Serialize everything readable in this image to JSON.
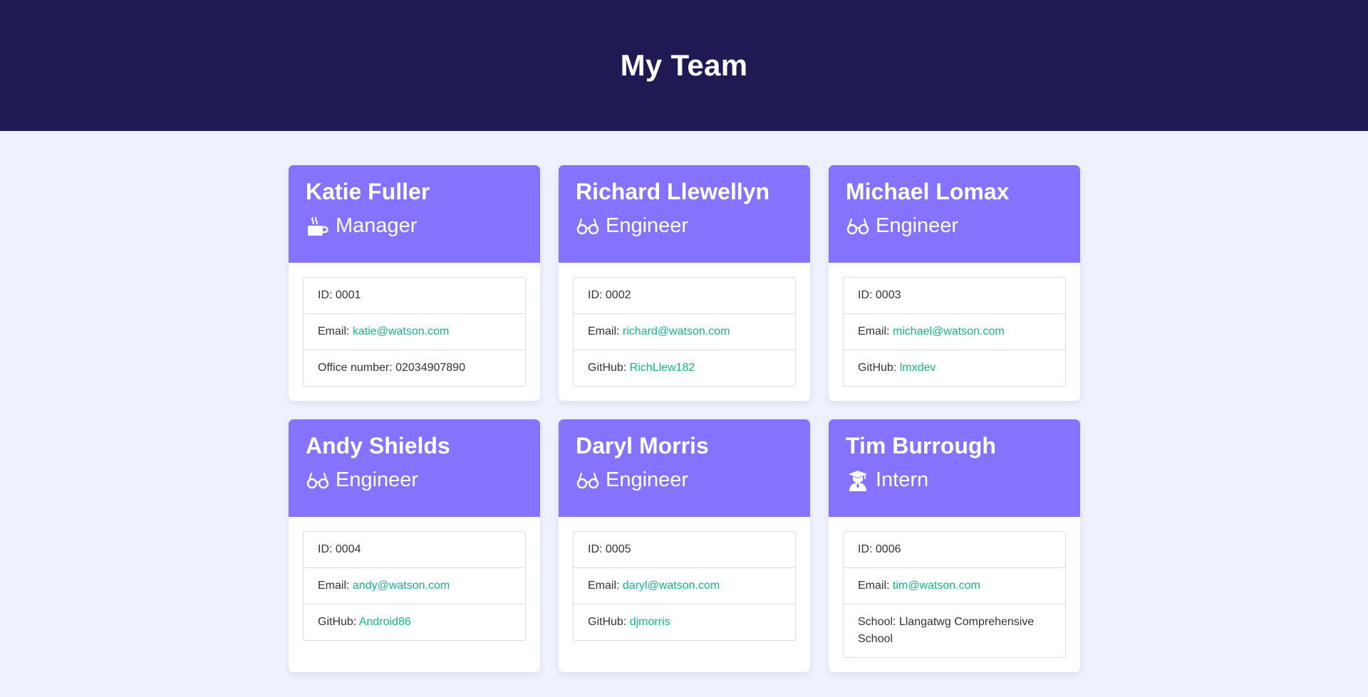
{
  "header": {
    "title": "My Team"
  },
  "colors": {
    "header_bg": "#201a54",
    "card_head_bg": "#8572ff",
    "link": "#13b38a",
    "page_bg": "#eff2fe"
  },
  "members": [
    {
      "name": "Katie Fuller",
      "role": "Manager",
      "icon": "coffee-mug-icon",
      "id_label": "ID: ",
      "id": "0001",
      "email_label": "Email: ",
      "email": "katie@watson.com",
      "extra_label": "Office number: ",
      "extra": "02034907890"
    },
    {
      "name": "Richard Llewellyn",
      "role": "Engineer",
      "icon": "glasses-icon",
      "id_label": "ID: ",
      "id": "0002",
      "email_label": "Email: ",
      "email": "richard@watson.com",
      "extra_label": "GitHub: ",
      "extra": "RichLlew182"
    },
    {
      "name": "Michael Lomax",
      "role": "Engineer",
      "icon": "glasses-icon",
      "id_label": "ID: ",
      "id": "0003",
      "email_label": "Email: ",
      "email": "michael@watson.com",
      "extra_label": "GitHub: ",
      "extra": "lmxdev"
    },
    {
      "name": "Andy Shields",
      "role": "Engineer",
      "icon": "glasses-icon",
      "id_label": "ID: ",
      "id": "0004",
      "email_label": "Email: ",
      "email": "andy@watson.com",
      "extra_label": "GitHub: ",
      "extra": "Android86"
    },
    {
      "name": "Daryl Morris",
      "role": "Engineer",
      "icon": "glasses-icon",
      "id_label": "ID: ",
      "id": "0005",
      "email_label": "Email: ",
      "email": "daryl@watson.com",
      "extra_label": "GitHub: ",
      "extra": "djmorris"
    },
    {
      "name": "Tim Burrough",
      "role": "Intern",
      "icon": "graduate-icon",
      "id_label": "ID: ",
      "id": "0006",
      "email_label": "Email: ",
      "email": "tim@watson.com",
      "extra_label": "School: ",
      "extra": "Llangatwg Comprehensive School"
    }
  ]
}
